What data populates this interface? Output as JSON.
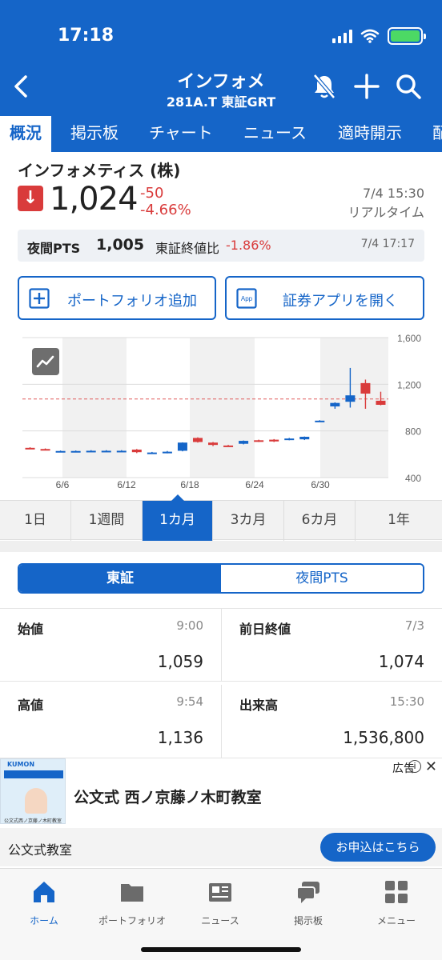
{
  "status_bar": {
    "time": "17:18"
  },
  "header": {
    "title": "インフォメ",
    "subtitle": "281A.T 東証GRT",
    "icons": [
      "chevron-left-icon",
      "bell-off-icon",
      "plus-icon",
      "search-icon"
    ]
  },
  "tabs": [
    {
      "label": "概況",
      "active": true
    },
    {
      "label": "掲示板"
    },
    {
      "label": "チャート"
    },
    {
      "label": "ニュース"
    },
    {
      "label": "適時開示"
    },
    {
      "label": "配"
    }
  ],
  "company": {
    "name": "インフォメティス (株)",
    "price": "1,024",
    "change": "-50",
    "change_pct": "-4.66%",
    "date": "7/4 15:30",
    "realtime": "リアルタイム"
  },
  "pts": {
    "label": "夜間PTS",
    "value": "1,005",
    "compare_label": "東証終値比",
    "compare_value": "-1.86%",
    "date": "7/4 17:17"
  },
  "actions": {
    "portfolio_add": "ポートフォリオ追加",
    "open_app": "証券アプリを開く",
    "app_icon_text": "App"
  },
  "chart_data": {
    "type": "candlestick",
    "x_tick_labels": [
      "6/6",
      "6/12",
      "6/18",
      "6/24",
      "6/30"
    ],
    "y_tick_labels": [
      "1,600",
      "1,200",
      "800",
      "400"
    ],
    "ylim": [
      400,
      1600
    ],
    "reference_line": 1074,
    "candles": [
      {
        "open": 655,
        "close": 650,
        "high": 660,
        "low": 645
      },
      {
        "open": 645,
        "close": 640,
        "high": 650,
        "low": 635
      },
      {
        "open": 625,
        "close": 628,
        "high": 632,
        "low": 620
      },
      {
        "open": 625,
        "close": 628,
        "high": 632,
        "low": 620
      },
      {
        "open": 628,
        "close": 630,
        "high": 635,
        "low": 622
      },
      {
        "open": 628,
        "close": 630,
        "high": 635,
        "low": 622
      },
      {
        "open": 628,
        "close": 630,
        "high": 635,
        "low": 622
      },
      {
        "open": 640,
        "close": 618,
        "high": 645,
        "low": 610
      },
      {
        "open": 612,
        "close": 615,
        "high": 620,
        "low": 608
      },
      {
        "open": 612,
        "close": 622,
        "high": 628,
        "low": 608
      },
      {
        "open": 630,
        "close": 700,
        "high": 702,
        "low": 625
      },
      {
        "open": 740,
        "close": 705,
        "high": 745,
        "low": 700
      },
      {
        "open": 700,
        "close": 680,
        "high": 705,
        "low": 670
      },
      {
        "open": 675,
        "close": 670,
        "high": 680,
        "low": 665
      },
      {
        "open": 690,
        "close": 715,
        "high": 718,
        "low": 685
      },
      {
        "open": 720,
        "close": 712,
        "high": 725,
        "low": 705
      },
      {
        "open": 725,
        "close": 710,
        "high": 730,
        "low": 705
      },
      {
        "open": 725,
        "close": 735,
        "high": 740,
        "low": 720
      },
      {
        "open": 728,
        "close": 750,
        "high": 752,
        "low": 722
      },
      {
        "open": 885,
        "close": 888,
        "high": 892,
        "low": 880
      },
      {
        "open": 1010,
        "close": 1040,
        "high": 1045,
        "low": 990
      },
      {
        "open": 1050,
        "close": 1105,
        "high": 1340,
        "low": 1000
      },
      {
        "open": 1210,
        "close": 1120,
        "high": 1240,
        "low": 990
      },
      {
        "open": 1059,
        "close": 1024,
        "high": 1136,
        "low": 1020
      }
    ]
  },
  "periods": [
    {
      "label": "1日"
    },
    {
      "label": "1週間"
    },
    {
      "label": "1カ月",
      "active": true
    },
    {
      "label": "3カ月"
    },
    {
      "label": "6カ月"
    },
    {
      "label": "1年"
    }
  ],
  "market_toggle": {
    "tse": "東証",
    "pts": "夜間PTS"
  },
  "quotes": {
    "open": {
      "label": "始値",
      "meta": "9:00",
      "value": "1,059"
    },
    "prev_close": {
      "label": "前日終値",
      "meta": "7/3",
      "value": "1,074"
    },
    "high": {
      "label": "高値",
      "meta": "9:54",
      "value": "1,136"
    },
    "volume": {
      "label": "出来高",
      "meta": "15:30",
      "value": "1,536,800"
    }
  },
  "ad": {
    "tag": "広告",
    "title": "公文式 西ノ京藤ノ木町教室",
    "thumb_brand": "KUMON",
    "thumb_caption": "公文式西ノ京藤ノ木町教室",
    "source": "公文式教室",
    "cta": "お申込はこちら"
  },
  "bottom_nav": [
    {
      "label": "ホーム",
      "icon": "home-icon",
      "active": true
    },
    {
      "label": "ポートフォリオ",
      "icon": "folder-icon"
    },
    {
      "label": "ニュース",
      "icon": "newspaper-icon"
    },
    {
      "label": "掲示板",
      "icon": "chat-icon"
    },
    {
      "label": "メニュー",
      "icon": "grid-icon"
    }
  ],
  "colors": {
    "primary": "#1565c8",
    "down": "#d93b3b",
    "up": "#1565c8"
  }
}
